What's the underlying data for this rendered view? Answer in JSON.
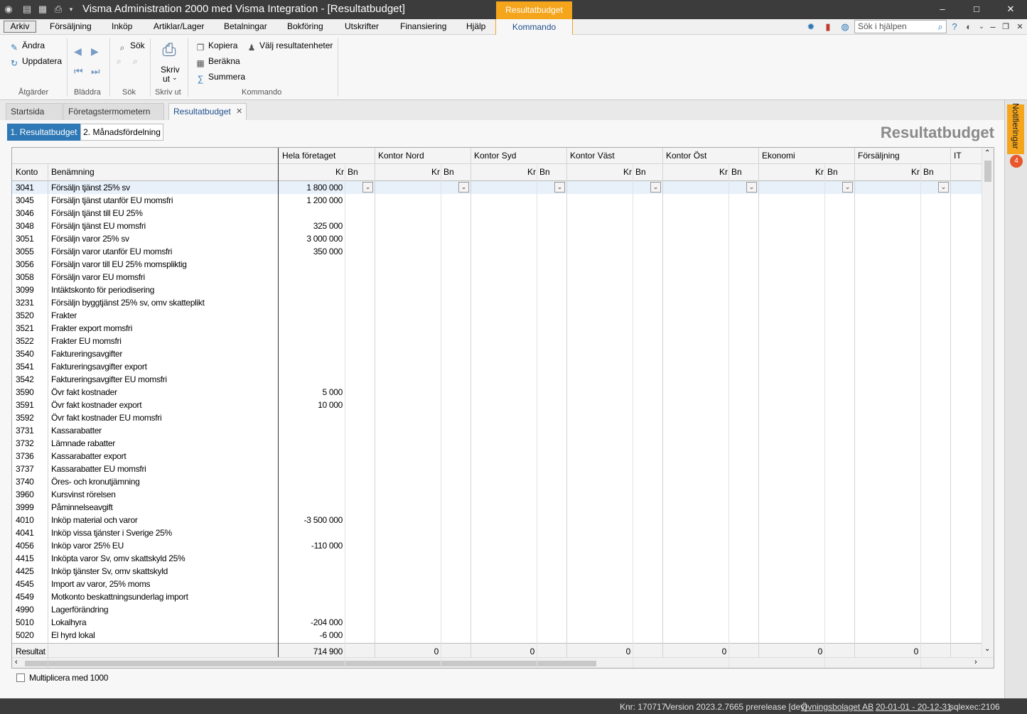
{
  "window": {
    "title": "Visma Administration 2000 med Visma Integration - [Resultatbudget]",
    "context_tab_title": "Resultatbudget",
    "controls": {
      "minimize": "–",
      "maximize": "□",
      "close": "✕"
    }
  },
  "menu": {
    "arkiv": "Arkiv",
    "items": [
      "Försäljning",
      "Inköp",
      "Artiklar/Lager",
      "Betalningar",
      "Bokföring",
      "Utskrifter",
      "Finansiering",
      "Hjälp"
    ],
    "active_tab": "Kommando",
    "help_search_placeholder": "Sök i hjälpen"
  },
  "ribbon": {
    "atgarder": {
      "label": "Åtgärder",
      "andra": "Ändra",
      "uppdatera": "Uppdatera"
    },
    "bladdra": {
      "label": "Bläddra"
    },
    "sok": {
      "label": "Sök",
      "sok": "Sök"
    },
    "skriv_ut": {
      "label": "Skriv ut",
      "button_line1": "Skriv",
      "button_line2": "ut"
    },
    "kommando": {
      "label": "Kommando",
      "kopiera": "Kopiera",
      "berakna": "Beräkna",
      "summera": "Summera",
      "valj": "Välj resultatenheter"
    }
  },
  "doc_tabs": [
    "Startsida",
    "Företagstermometern",
    "Resultatbudget"
  ],
  "sub_tabs": [
    "1. Resultatbudget",
    "2. Månadsfördelning"
  ],
  "page_heading": "Resultatbudget",
  "grid": {
    "col_konto": "Konto",
    "col_benamning": "Benämning",
    "units": [
      "Hela företaget",
      "Kontor Nord",
      "Kontor Syd",
      "Kontor Väst",
      "Kontor Öst",
      "Ekonomi",
      "Försäljning",
      "IT"
    ],
    "kr": "Kr",
    "bn": "Bn",
    "rows": [
      {
        "konto": "3041",
        "name": "Försäljn tjänst 25% sv",
        "value": "1 800 000"
      },
      {
        "konto": "3045",
        "name": "Försäljn tjänst utanför EU momsfri",
        "value": "1 200 000"
      },
      {
        "konto": "3046",
        "name": "Försäljn tjänst till EU 25%",
        "value": ""
      },
      {
        "konto": "3048",
        "name": "Försäljn tjänst EU momsfri",
        "value": "325 000"
      },
      {
        "konto": "3051",
        "name": "Försäljn varor 25% sv",
        "value": "3 000 000"
      },
      {
        "konto": "3055",
        "name": "Försäljn varor utanför EU momsfri",
        "value": "350 000"
      },
      {
        "konto": "3056",
        "name": "Försäljn varor till EU 25% momspliktig",
        "value": ""
      },
      {
        "konto": "3058",
        "name": "Försäljn varor EU momsfri",
        "value": ""
      },
      {
        "konto": "3099",
        "name": "Intäktskonto för periodisering",
        "value": ""
      },
      {
        "konto": "3231",
        "name": "Försäljn byggtjänst 25% sv, omv skatteplikt",
        "value": ""
      },
      {
        "konto": "3520",
        "name": "Frakter",
        "value": ""
      },
      {
        "konto": "3521",
        "name": "Frakter export momsfri",
        "value": ""
      },
      {
        "konto": "3522",
        "name": "Frakter EU momsfri",
        "value": ""
      },
      {
        "konto": "3540",
        "name": "Faktureringsavgifter",
        "value": ""
      },
      {
        "konto": "3541",
        "name": "Faktureringsavgifter export",
        "value": ""
      },
      {
        "konto": "3542",
        "name": "Faktureringsavgifter EU momsfri",
        "value": ""
      },
      {
        "konto": "3590",
        "name": "Övr fakt kostnader",
        "value": "5 000"
      },
      {
        "konto": "3591",
        "name": "Övr fakt kostnader export",
        "value": "10 000"
      },
      {
        "konto": "3592",
        "name": "Övr fakt kostnader EU momsfri",
        "value": ""
      },
      {
        "konto": "3731",
        "name": "Kassarabatter",
        "value": ""
      },
      {
        "konto": "3732",
        "name": "Lämnade rabatter",
        "value": ""
      },
      {
        "konto": "3736",
        "name": "Kassarabatter export",
        "value": ""
      },
      {
        "konto": "3737",
        "name": "Kassarabatter EU momsfri",
        "value": ""
      },
      {
        "konto": "3740",
        "name": "Öres- och kronutjämning",
        "value": ""
      },
      {
        "konto": "3960",
        "name": "Kursvinst rörelsen",
        "value": ""
      },
      {
        "konto": "3999",
        "name": "Påminnelseavgift",
        "value": ""
      },
      {
        "konto": "4010",
        "name": "Inköp material och varor",
        "value": "-3 500 000"
      },
      {
        "konto": "4041",
        "name": "Inköp vissa tjänster i Sverige 25%",
        "value": ""
      },
      {
        "konto": "4056",
        "name": "Inköp varor 25% EU",
        "value": "-110 000"
      },
      {
        "konto": "4415",
        "name": "Inköpta varor Sv, omv skattskyld 25%",
        "value": ""
      },
      {
        "konto": "4425",
        "name": "Inköp tjänster Sv, omv skattskyld",
        "value": ""
      },
      {
        "konto": "4545",
        "name": "Import av varor, 25% moms",
        "value": ""
      },
      {
        "konto": "4549",
        "name": "Motkonto beskattningsunderlag import",
        "value": ""
      },
      {
        "konto": "4990",
        "name": "Lagerförändring",
        "value": ""
      },
      {
        "konto": "5010",
        "name": "Lokalhyra",
        "value": "-204 000"
      },
      {
        "konto": "5020",
        "name": "El hyrd lokal",
        "value": "-6 000"
      }
    ],
    "summary_label": "Resultat",
    "summary_values": [
      "714 900",
      "0",
      "0",
      "0",
      "0",
      "0",
      "0"
    ]
  },
  "checkbox_label": "Multiplicera med 1000",
  "status": {
    "knr": "Knr: 170717",
    "version": "Version 2023.2.7665 prerelease [dev]",
    "company": "Övningsbolaget AB",
    "period": "20-01-01 - 20-12-31",
    "sql": "sqlexec:2106"
  },
  "notifications": {
    "label": "Notifieringar",
    "count": "4"
  }
}
